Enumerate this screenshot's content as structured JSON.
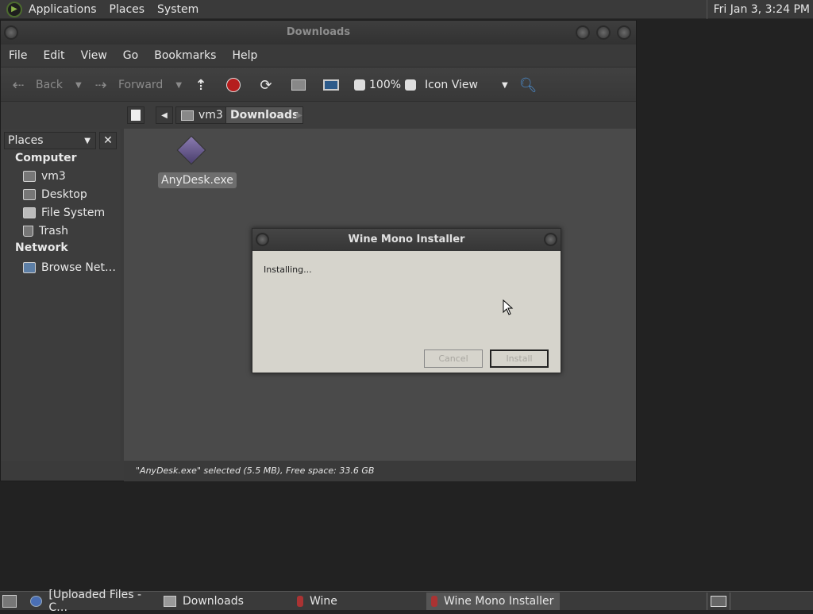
{
  "top_panel": {
    "menus": [
      "Applications",
      "Places",
      "System"
    ],
    "clock": "Fri Jan 3, 3:24 PM"
  },
  "file_manager": {
    "title": "Downloads",
    "menu": [
      "File",
      "Edit",
      "View",
      "Go",
      "Bookmarks",
      "Help"
    ],
    "toolbar": {
      "back": "Back",
      "forward": "Forward",
      "zoom": "100%",
      "view_mode": "Icon View"
    },
    "path": [
      "vm3",
      "Downloads"
    ],
    "sidebar": {
      "selector": "Places",
      "computer_heading": "Computer",
      "computer_items": [
        "vm3",
        "Desktop",
        "File System",
        "Trash"
      ],
      "network_heading": "Network",
      "network_items": [
        "Browse Net…"
      ]
    },
    "files": [
      {
        "name": "AnyDesk.exe",
        "icon": "exe-diamond-icon"
      }
    ],
    "status": "\"AnyDesk.exe\" selected (5.5 MB), Free space: 33.6 GB"
  },
  "dialog": {
    "title": "Wine Mono Installer",
    "message": "Installing...",
    "cancel": "Cancel",
    "install": "Install"
  },
  "taskbar": {
    "tasks": [
      "[Uploaded Files - C…",
      "Downloads",
      "Wine",
      "Wine Mono Installer"
    ]
  }
}
